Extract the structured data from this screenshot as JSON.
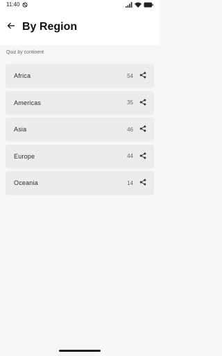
{
  "status_bar": {
    "time": "11:40"
  },
  "app_bar": {
    "title": "By Region"
  },
  "section_label": "Quiz by continent",
  "regions": [
    {
      "label": "Africa",
      "count": "54"
    },
    {
      "label": "Americas",
      "count": "35"
    },
    {
      "label": "Asia",
      "count": "46"
    },
    {
      "label": "Europe",
      "count": "44"
    },
    {
      "label": "Oceania",
      "count": "14"
    }
  ],
  "icons": {
    "back": "arrow-left-icon",
    "share": "share-icon"
  }
}
